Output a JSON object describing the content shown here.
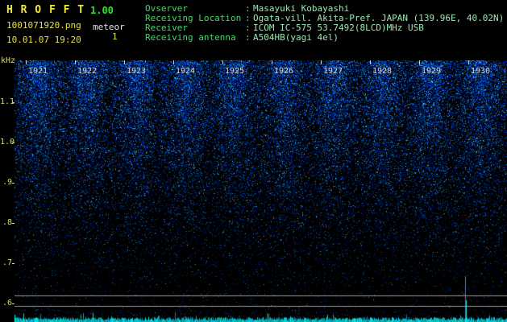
{
  "app": {
    "title": "H R O F F T",
    "version": "1.00",
    "filename": "1001071920.png",
    "mode": "meteor",
    "count": "1",
    "datetime": "10.01.07 19:20"
  },
  "header": {
    "separator": ":",
    "fields": [
      {
        "label": "Ovserver",
        "value": "Masayuki Kobayashi"
      },
      {
        "label": "Receiving Location",
        "value": "Ogata-vill. Akita-Pref. JAPAN (139.96E, 40.02N)"
      },
      {
        "label": "Receiver",
        "value": "ICOM IC-575 53.7492(8LCD)MHz USB"
      },
      {
        "label": "Receiving antenna",
        "value": "A504HB(yagi 4el)"
      }
    ]
  },
  "spectrogram": {
    "y_unit": "kHz",
    "y_ticks": [
      "1.1",
      "1.0",
      ".9",
      ".8",
      ".7",
      ".6"
    ],
    "x_ticks": [
      "1921",
      "1922",
      "1923",
      "1924",
      "1925",
      "1926",
      "1927",
      "1928",
      "1929",
      "1930"
    ],
    "colors": {
      "background": "#000000",
      "speckle_blue": "#1133cc",
      "bright_speckle": "#00ccff",
      "baseline_cyan": "#00ffff",
      "reference_line": "#9a9a9a",
      "axis_label": "#dedc62",
      "time_label": "#d4d4d4",
      "title_yellow": "#f0ea38",
      "version_green": "#2ee22e",
      "header_green": "#43d969"
    }
  }
}
